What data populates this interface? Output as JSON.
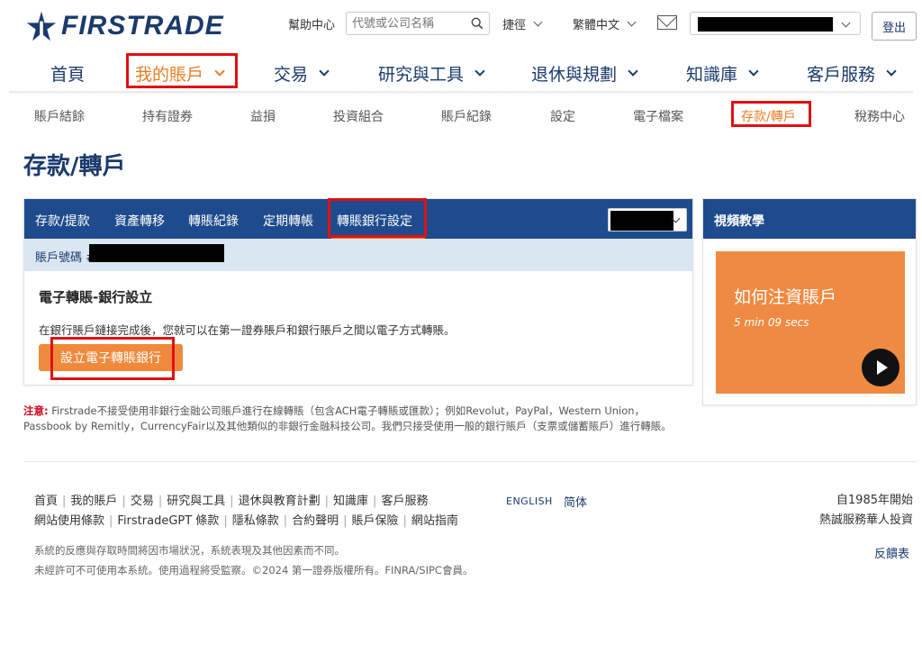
{
  "brand": {
    "name": "FIRSTRADE",
    "color": "#1a3a6c",
    "accent": "#e67e22",
    "highlight": "#e01010"
  },
  "header": {
    "help": "幫助中心",
    "search_placeholder": "代號或公司名稱",
    "shortcut": "捷徑",
    "language": "繁體中文",
    "logout": "登出"
  },
  "main_nav": [
    {
      "label": "首頁"
    },
    {
      "label": "我的賬戶",
      "active": true
    },
    {
      "label": "交易"
    },
    {
      "label": "研究與工具"
    },
    {
      "label": "退休與規劃"
    },
    {
      "label": "知識庫"
    },
    {
      "label": "客戶服務"
    }
  ],
  "sub_nav": [
    {
      "label": "賬戶結餘"
    },
    {
      "label": "持有證券"
    },
    {
      "label": "益損"
    },
    {
      "label": "投資組合"
    },
    {
      "label": "賬戶紀錄"
    },
    {
      "label": "設定"
    },
    {
      "label": "電子檔案"
    },
    {
      "label": "存款/轉戶",
      "active": true
    },
    {
      "label": "稅務中心"
    }
  ],
  "page_title": "存款/轉戶",
  "panel": {
    "tabs": [
      {
        "label": "存款/提款"
      },
      {
        "label": "資產轉移"
      },
      {
        "label": "轉賬紀錄"
      },
      {
        "label": "定期轉帳"
      },
      {
        "label": "轉賬銀行設定",
        "active": true
      }
    ],
    "account_label": "賬戶號碼 #",
    "section_title": "電子轉賬-銀行設立",
    "section_desc": "在銀行賬戶鏈接完成後，您就可以在第一證券賬戶和銀行賬戶之間以電子方式轉賬。",
    "setup_button": "設立電子轉賬銀行"
  },
  "notice": {
    "label": "注意:",
    "text": " Firstrade不接受使用非銀行金融公司賬戶進行在線轉賬（包含ACH電子轉賬或匯款）；例如Revolut，PayPal，Western Union，Passbook by Remitly，CurrencyFair以及其他類似的非銀行金融科技公司。我們只接受使用一般的銀行賬戶（支票或儲蓄賬戶）進行轉賬。"
  },
  "video": {
    "header": "視頻教學",
    "title": "如何注資賬戶",
    "duration": "5 min 09 secs",
    "thumb_color": "#ef8a42"
  },
  "footer": {
    "links_row1": [
      "首頁",
      "我的賬戶",
      "交易",
      "研究與工具",
      "退休與教育計劃",
      "知識庫",
      "客戶服務"
    ],
    "links_row2": [
      "網站使用條款",
      "FirstradeGPT 條款",
      "隱私條款",
      "合約聲明",
      "賬戶保險",
      "網站指南"
    ],
    "lang_en": "ENGLISH",
    "lang_sc": "简体",
    "since_line1": "自1985年開始",
    "since_line2": "熱誠服務華人投資",
    "disclaimer1": "系統的反應與存取時間將因市場狀況，系統表現及其他因素而不同。",
    "disclaimer2": "未經許可不可使用本系統。使用過程將受監察。©2024 第一證券版權所有。FINRA/SIPC會員。",
    "feedback": "反饋表"
  }
}
